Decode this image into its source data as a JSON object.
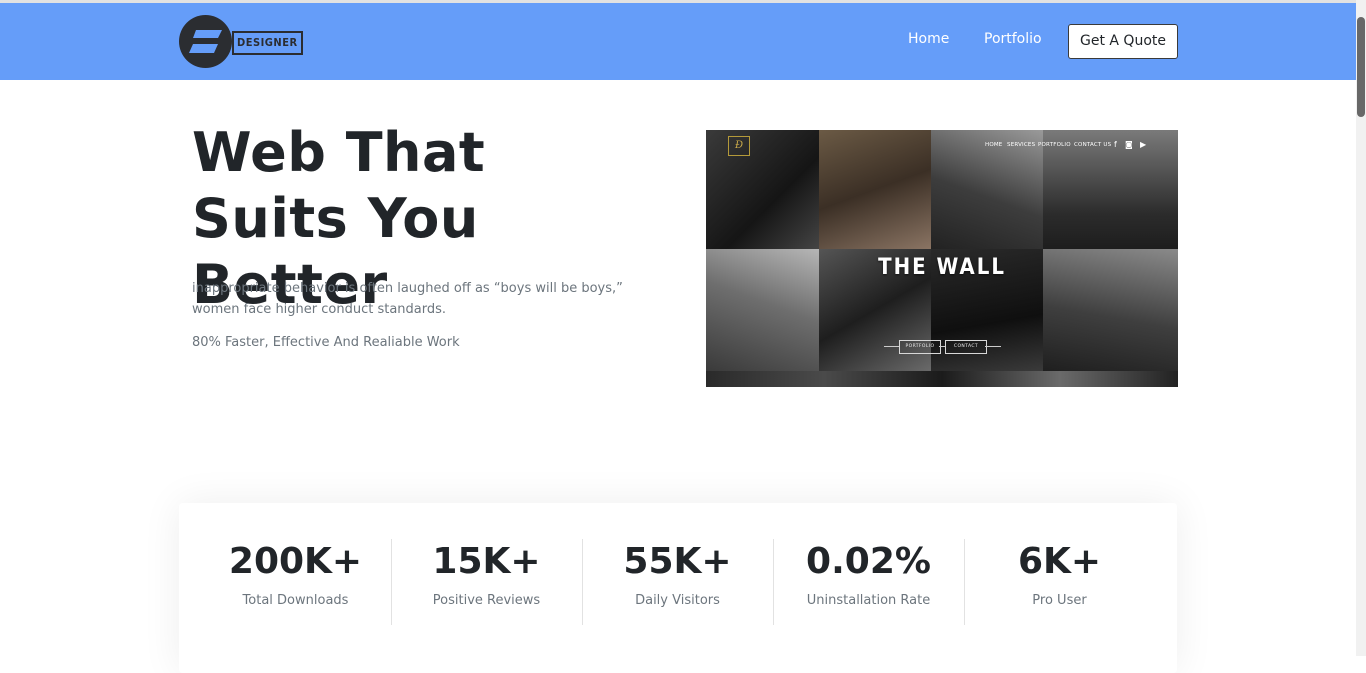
{
  "header": {
    "logo_text": "DESIGNER",
    "nav": [
      "Home",
      "Portfolio"
    ],
    "cta_label": "Get A Quote",
    "background_color": "#659df9"
  },
  "hero": {
    "title_line1": "Web That",
    "title_line2": "Suits You Better",
    "description": "inappropriate behavior is often laughed off as “boys will be boys,” women face higher conduct standards.",
    "subtext": "80% Faster, Effective And Realiable Work"
  },
  "preview": {
    "nav": [
      "HOME",
      "SERVICES",
      "PORTFOLIO",
      "CONTACT US"
    ],
    "title": "THE WALL",
    "buttons": [
      "PORTFOLIO",
      "CONTACT"
    ]
  },
  "stats": [
    {
      "value": "200K+",
      "label": "Total Downloads"
    },
    {
      "value": "15K+",
      "label": "Positive Reviews"
    },
    {
      "value": "55K+",
      "label": "Daily Visitors"
    },
    {
      "value": "0.02%",
      "label": "Uninstallation Rate"
    },
    {
      "value": "6K+",
      "label": "Pro User"
    }
  ]
}
